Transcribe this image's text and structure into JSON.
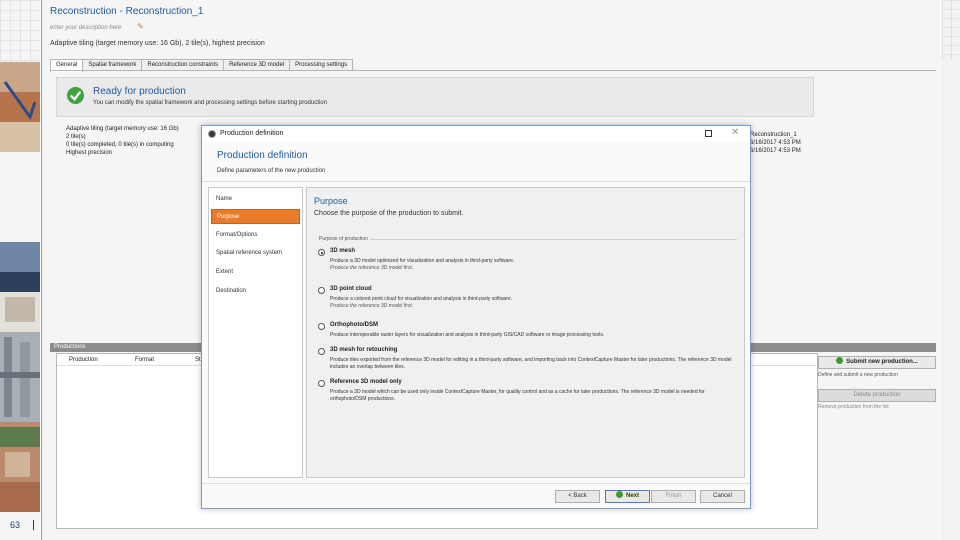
{
  "window": {
    "title": "Reconstruction - Reconstruction_1",
    "description_placeholder": "enter your description here",
    "summary": "Adaptive tiling (target memory use: 16 Gb), 2 tile(s), highest precision"
  },
  "tabs": [
    "General",
    "Spatial framework",
    "Reconstruction constraints",
    "Reference 3D model",
    "Processing settings"
  ],
  "status": {
    "title": "Ready for production",
    "description": "You can modify the spatial framework and processing settings before starting production"
  },
  "info_left": [
    "Adaptive tiling (target memory use: 16 Gb)",
    "2 tile(s)",
    "0 tile(s) completed, 0 tile(s) in computing",
    "Highest precision"
  ],
  "info_right": [
    "Reconstruction_1",
    "6/16/2017 4:53 PM",
    "6/16/2017 4:53 PM"
  ],
  "productions": {
    "header": "Productions",
    "columns": [
      "Production",
      "Format",
      "St"
    ]
  },
  "side_actions": {
    "submit_label": "Submit new production...",
    "submit_desc": "Define and submit a new production",
    "delete_label": "Delete production",
    "delete_desc": "Remove production from the list"
  },
  "dialog": {
    "window_title": "Production definition",
    "heading": "Production definition",
    "subheading": "Define parameters of the new production",
    "nav": [
      "Name",
      "Purpose",
      "Format/Options",
      "Spatial reference system",
      "Extent",
      "Destination"
    ],
    "active_nav": 1,
    "content_title": "Purpose",
    "content_desc": "Choose the purpose of the production to submit.",
    "group_label": "Purpose of production",
    "options": [
      {
        "label": "3D mesh",
        "desc": "Produce a 3D model optimized for visualization and analysis in third-party software.",
        "note": "Produce the reference 3D model first.",
        "checked": true
      },
      {
        "label": "3D point cloud",
        "desc": "Produce a colored point cloud for visualization and analysis in third-party software.",
        "note": "Produce the reference 3D model first.",
        "checked": false
      },
      {
        "label": "Orthophoto/DSM",
        "desc": "Produce interoperable raster layers for visualization and analysis in third-party GIS/CAD software or image processing tools.",
        "note": "",
        "checked": false
      },
      {
        "label": "3D mesh for retouching",
        "desc": "Produce tiles exported from the reference 3D model for editing in a third-party software, and importing back into ContextCapture Master for later productions. The reference 3D model includes an overlap between tiles.",
        "note": "",
        "checked": false
      },
      {
        "label": "Reference 3D model only",
        "desc": "Produce a 3D model which can be used only inside ContextCapture Master, for quality control and as a cache for later productions. The reference 3D model is needed for orthophoto/DSM productions.",
        "note": "",
        "checked": false
      }
    ],
    "buttons": {
      "back": "< Back",
      "next": "Next",
      "finish": "Finish",
      "cancel": "Cancel"
    }
  },
  "slide": {
    "number": "63"
  }
}
